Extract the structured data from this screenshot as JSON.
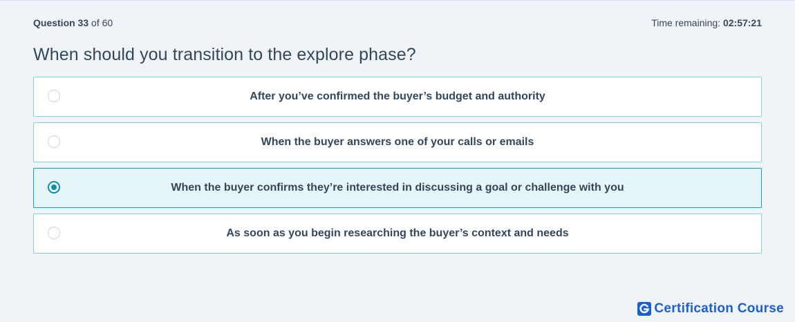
{
  "header": {
    "question_label": "Question 33",
    "of_total": "of 60",
    "timer_label": "Time remaining:",
    "timer_value": "02:57:21"
  },
  "question": {
    "text": "When should you transition to the explore phase?"
  },
  "options": [
    {
      "label": "After you’ve confirmed the buyer’s budget and authority",
      "selected": false
    },
    {
      "label": "When the buyer answers one of your calls or emails",
      "selected": false
    },
    {
      "label": "When the buyer confirms they’re interested in discussing a goal or challenge with you",
      "selected": true
    },
    {
      "label": "As soon as you begin researching the buyer’s context and needs",
      "selected": false
    }
  ],
  "brand": {
    "icon": "g-logo-icon",
    "text": "Certification Course"
  },
  "colors": {
    "background": "#f0f3f8",
    "option_border": "#7fd1de",
    "selected_background": "#e5f5f8",
    "selected_accent": "#0091ae",
    "brand": "#1a5fd0"
  }
}
